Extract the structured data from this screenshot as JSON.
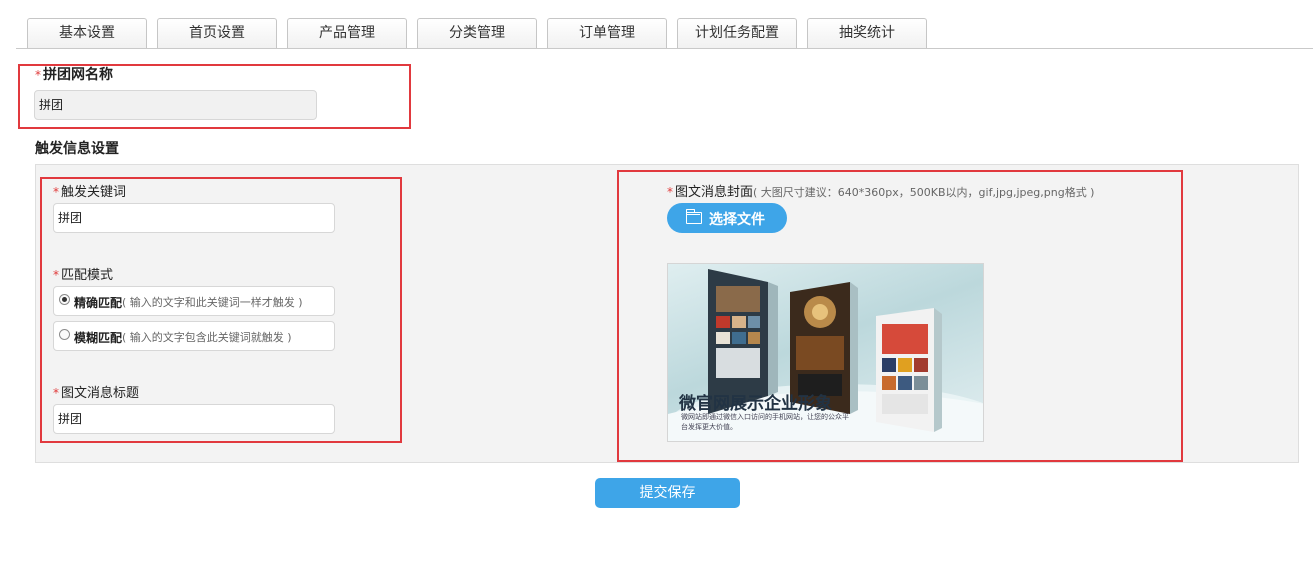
{
  "tabs": [
    "基本设置",
    "首页设置",
    "产品管理",
    "分类管理",
    "订单管理",
    "计划任务配置",
    "抽奖统计"
  ],
  "group_name": {
    "label": "拼团网名称",
    "value": "拼团"
  },
  "trigger_section_title": "触发信息设置",
  "keyword": {
    "label": "触发关键词",
    "value": "拼团"
  },
  "match_mode": {
    "label": "匹配模式",
    "options": [
      {
        "label": "精确匹配",
        "hint": "( 输入的文字和此关键词一样才触发 )",
        "checked": true
      },
      {
        "label": "模糊匹配",
        "hint": "( 输入的文字包含此关键词就触发 )",
        "checked": false
      }
    ]
  },
  "message_title": {
    "label": "图文消息标题",
    "value": "拼团"
  },
  "cover": {
    "label": "图文消息封面",
    "hint": "( 大图尺寸建议：640*360px，500KB以内，gif,jpg,jpeg,png格式 )",
    "button": "选择文件",
    "image_title": "微官网展示企业形象",
    "image_subtitle": "微网站即通过微信入口访问的手机网站，让您的公众平台发挥更大价值。"
  },
  "submit_label": "提交保存",
  "colors": {
    "accent": "#3ea5e8",
    "required": "#e03a3a",
    "annotation": "#e1393e"
  }
}
